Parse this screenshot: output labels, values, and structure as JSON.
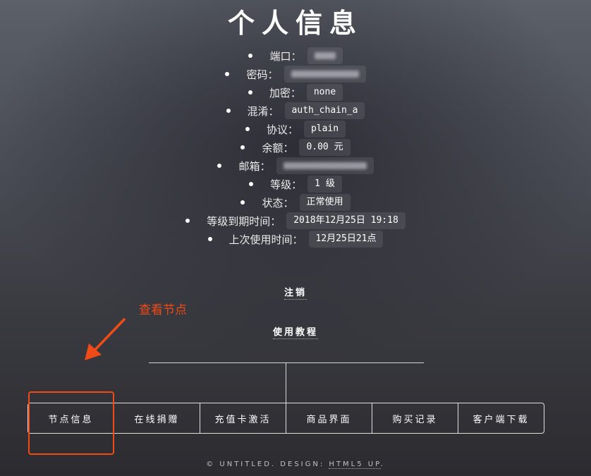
{
  "page": {
    "title": "个人信息"
  },
  "info": [
    {
      "label": "端口：",
      "value": ""
    },
    {
      "label": "密码：",
      "value": ""
    },
    {
      "label": "加密：",
      "value": "none"
    },
    {
      "label": "混淆：",
      "value": "auth_chain_a"
    },
    {
      "label": "协议：",
      "value": "plain"
    },
    {
      "label": "余额：",
      "value": "0.00 元"
    },
    {
      "label": "邮箱：",
      "value": ""
    },
    {
      "label": "等级：",
      "value": "1 级"
    },
    {
      "label": "状态：",
      "value": "正常使用"
    },
    {
      "label": "等级到期时间：",
      "value": "2018年12月25日 19:18"
    },
    {
      "label": "上次使用时间：",
      "value": "12月25日21点"
    }
  ],
  "links": {
    "logout": "注销",
    "tutorial": "使用教程"
  },
  "annotation": {
    "text": "查看节点",
    "color": "#f04a16"
  },
  "nav": [
    "节点信息",
    "在线捐赠",
    "充值卡激活",
    "商品界面",
    "购买记录",
    "客户端下载"
  ],
  "footer": {
    "copyright": "© UNTITLED. DESIGN:",
    "link": "HTML5 UP",
    "end": "."
  }
}
